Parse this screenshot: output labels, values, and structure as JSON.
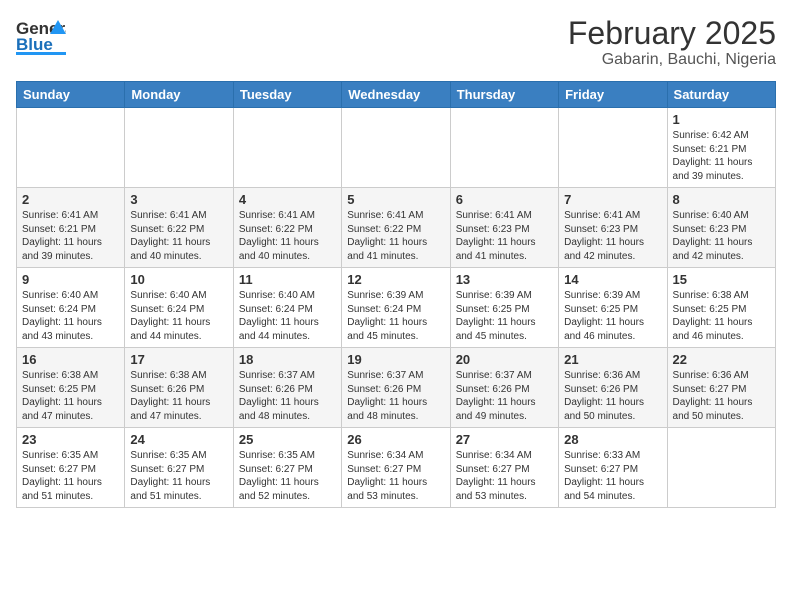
{
  "header": {
    "logo_line1": "General",
    "logo_line2": "Blue",
    "title": "February 2025",
    "subtitle": "Gabarin, Bauchi, Nigeria"
  },
  "calendar": {
    "days_of_week": [
      "Sunday",
      "Monday",
      "Tuesday",
      "Wednesday",
      "Thursday",
      "Friday",
      "Saturday"
    ],
    "weeks": [
      [
        {
          "day": "",
          "info": ""
        },
        {
          "day": "",
          "info": ""
        },
        {
          "day": "",
          "info": ""
        },
        {
          "day": "",
          "info": ""
        },
        {
          "day": "",
          "info": ""
        },
        {
          "day": "",
          "info": ""
        },
        {
          "day": "1",
          "info": "Sunrise: 6:42 AM\nSunset: 6:21 PM\nDaylight: 11 hours\nand 39 minutes."
        }
      ],
      [
        {
          "day": "2",
          "info": "Sunrise: 6:41 AM\nSunset: 6:21 PM\nDaylight: 11 hours\nand 39 minutes."
        },
        {
          "day": "3",
          "info": "Sunrise: 6:41 AM\nSunset: 6:22 PM\nDaylight: 11 hours\nand 40 minutes."
        },
        {
          "day": "4",
          "info": "Sunrise: 6:41 AM\nSunset: 6:22 PM\nDaylight: 11 hours\nand 40 minutes."
        },
        {
          "day": "5",
          "info": "Sunrise: 6:41 AM\nSunset: 6:22 PM\nDaylight: 11 hours\nand 41 minutes."
        },
        {
          "day": "6",
          "info": "Sunrise: 6:41 AM\nSunset: 6:23 PM\nDaylight: 11 hours\nand 41 minutes."
        },
        {
          "day": "7",
          "info": "Sunrise: 6:41 AM\nSunset: 6:23 PM\nDaylight: 11 hours\nand 42 minutes."
        },
        {
          "day": "8",
          "info": "Sunrise: 6:40 AM\nSunset: 6:23 PM\nDaylight: 11 hours\nand 42 minutes."
        }
      ],
      [
        {
          "day": "9",
          "info": "Sunrise: 6:40 AM\nSunset: 6:24 PM\nDaylight: 11 hours\nand 43 minutes."
        },
        {
          "day": "10",
          "info": "Sunrise: 6:40 AM\nSunset: 6:24 PM\nDaylight: 11 hours\nand 44 minutes."
        },
        {
          "day": "11",
          "info": "Sunrise: 6:40 AM\nSunset: 6:24 PM\nDaylight: 11 hours\nand 44 minutes."
        },
        {
          "day": "12",
          "info": "Sunrise: 6:39 AM\nSunset: 6:24 PM\nDaylight: 11 hours\nand 45 minutes."
        },
        {
          "day": "13",
          "info": "Sunrise: 6:39 AM\nSunset: 6:25 PM\nDaylight: 11 hours\nand 45 minutes."
        },
        {
          "day": "14",
          "info": "Sunrise: 6:39 AM\nSunset: 6:25 PM\nDaylight: 11 hours\nand 46 minutes."
        },
        {
          "day": "15",
          "info": "Sunrise: 6:38 AM\nSunset: 6:25 PM\nDaylight: 11 hours\nand 46 minutes."
        }
      ],
      [
        {
          "day": "16",
          "info": "Sunrise: 6:38 AM\nSunset: 6:25 PM\nDaylight: 11 hours\nand 47 minutes."
        },
        {
          "day": "17",
          "info": "Sunrise: 6:38 AM\nSunset: 6:26 PM\nDaylight: 11 hours\nand 47 minutes."
        },
        {
          "day": "18",
          "info": "Sunrise: 6:37 AM\nSunset: 6:26 PM\nDaylight: 11 hours\nand 48 minutes."
        },
        {
          "day": "19",
          "info": "Sunrise: 6:37 AM\nSunset: 6:26 PM\nDaylight: 11 hours\nand 48 minutes."
        },
        {
          "day": "20",
          "info": "Sunrise: 6:37 AM\nSunset: 6:26 PM\nDaylight: 11 hours\nand 49 minutes."
        },
        {
          "day": "21",
          "info": "Sunrise: 6:36 AM\nSunset: 6:26 PM\nDaylight: 11 hours\nand 50 minutes."
        },
        {
          "day": "22",
          "info": "Sunrise: 6:36 AM\nSunset: 6:27 PM\nDaylight: 11 hours\nand 50 minutes."
        }
      ],
      [
        {
          "day": "23",
          "info": "Sunrise: 6:35 AM\nSunset: 6:27 PM\nDaylight: 11 hours\nand 51 minutes."
        },
        {
          "day": "24",
          "info": "Sunrise: 6:35 AM\nSunset: 6:27 PM\nDaylight: 11 hours\nand 51 minutes."
        },
        {
          "day": "25",
          "info": "Sunrise: 6:35 AM\nSunset: 6:27 PM\nDaylight: 11 hours\nand 52 minutes."
        },
        {
          "day": "26",
          "info": "Sunrise: 6:34 AM\nSunset: 6:27 PM\nDaylight: 11 hours\nand 53 minutes."
        },
        {
          "day": "27",
          "info": "Sunrise: 6:34 AM\nSunset: 6:27 PM\nDaylight: 11 hours\nand 53 minutes."
        },
        {
          "day": "28",
          "info": "Sunrise: 6:33 AM\nSunset: 6:27 PM\nDaylight: 11 hours\nand 54 minutes."
        },
        {
          "day": "",
          "info": ""
        }
      ]
    ]
  }
}
